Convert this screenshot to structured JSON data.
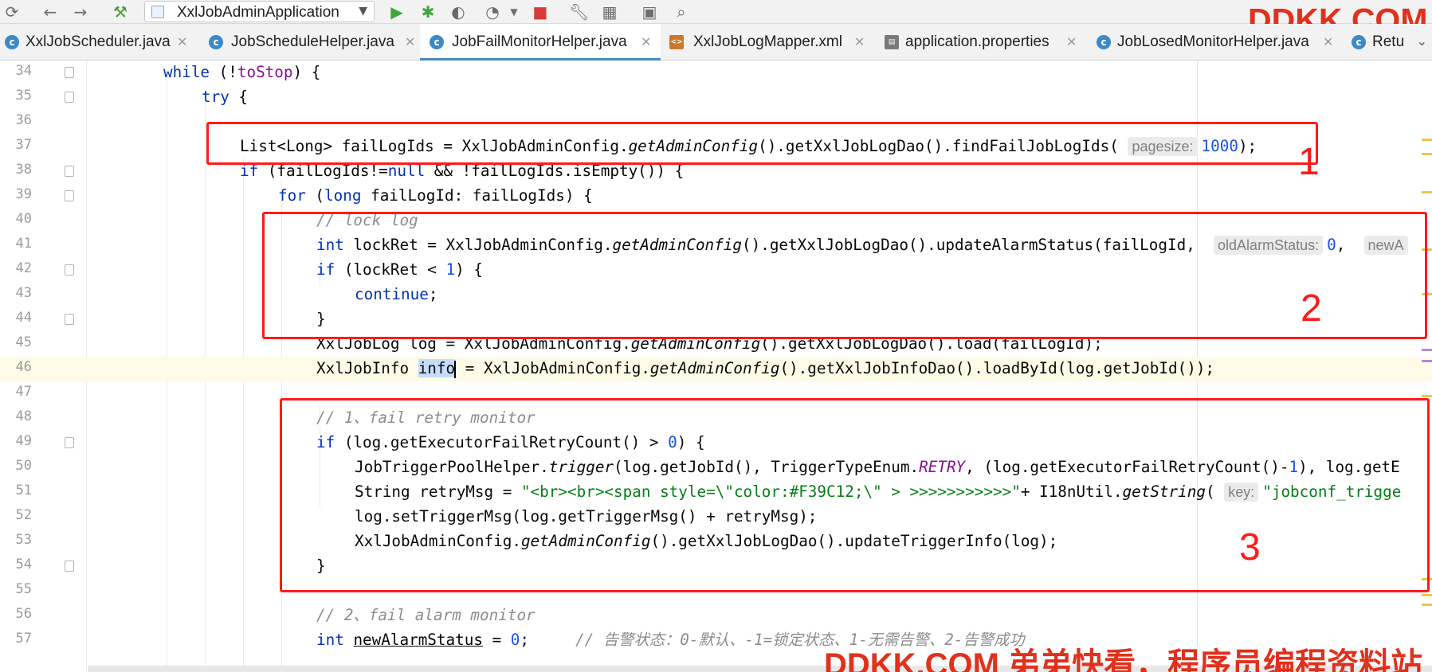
{
  "toolbar": {
    "icons": [
      "sync-icon",
      "back-arrow-icon",
      "forward-arrow-icon",
      "build-hammer-icon",
      "run-icon",
      "debug-icon",
      "coverage-icon",
      "profile-icon",
      "stop-icon",
      "settings-wrench-icon",
      "project-structure-icon",
      "terminal-icon",
      "search-icon"
    ],
    "run_config": "XxlJobAdminApplication"
  },
  "watermark_top": "DDKK.COM",
  "tabs": [
    {
      "label": "XxlJobScheduler.java",
      "icon": "class-icon",
      "active": false
    },
    {
      "label": "JobScheduleHelper.java",
      "icon": "class-icon",
      "active": false
    },
    {
      "label": "JobFailMonitorHelper.java",
      "icon": "class-icon",
      "active": true
    },
    {
      "label": "XxlJobLogMapper.xml",
      "icon": "xml-icon",
      "active": false
    },
    {
      "label": "application.properties",
      "icon": "properties-icon",
      "active": false
    },
    {
      "label": "JobLosedMonitorHelper.java",
      "icon": "class-icon",
      "active": false
    },
    {
      "label": "Retu",
      "icon": "class-icon",
      "active": false
    }
  ],
  "editor": {
    "line_numbers": [
      "34",
      "35",
      "36",
      "37",
      "38",
      "39",
      "40",
      "41",
      "42",
      "43",
      "44",
      "45",
      "46",
      "47",
      "48",
      "49",
      "50",
      "51",
      "52",
      "53",
      "54",
      "55",
      "56",
      "57"
    ],
    "current_line": "46",
    "hints": {
      "pagesize": "pagesize:",
      "old_alarm_status": "oldAlarmStatus:",
      "new_alarm": "newA",
      "key": "key:"
    },
    "comments": {
      "lock_log": "// lock log",
      "fail_retry": "// 1、fail retry monitor",
      "fail_alarm": "// 2、fail alarm monitor",
      "alarm_status": "// 告警状态：0-默认、-1=锁定状态、1-无需告警、2-告警成功"
    },
    "strings": {
      "retry_span": "\"<br><br><span style=\\\"color:#F39C12;\\\" > >>>>>>>>>>>\"",
      "jobconf_trigger": "\"jobconf_trigge"
    }
  },
  "annotations": [
    "1",
    "2",
    "3"
  ],
  "watermark_bottom": "DDKK.COM 弟弟快看，程序员编程资料站"
}
